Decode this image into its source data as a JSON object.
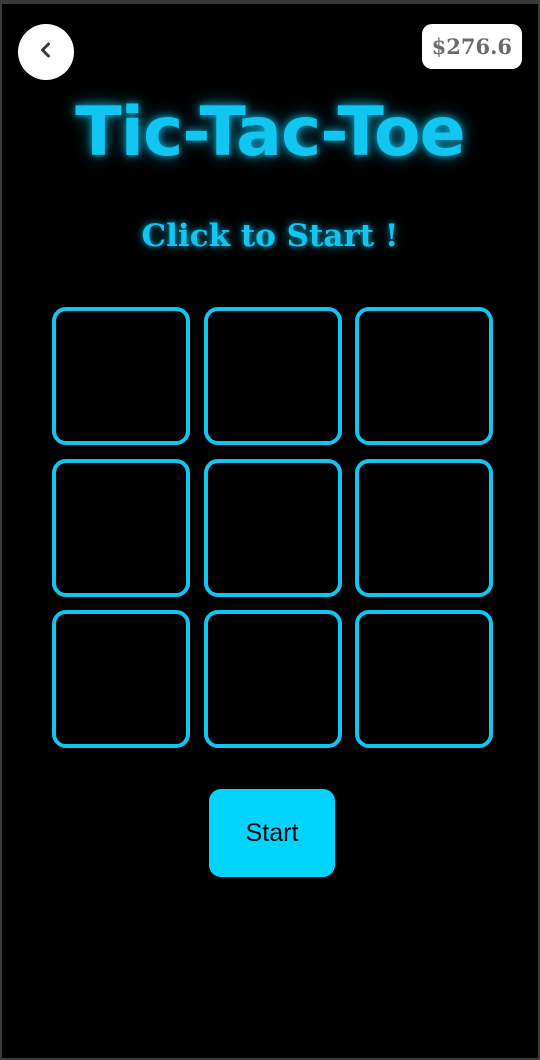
{
  "header": {
    "back_icon": "chevron-left-icon",
    "balance": "$276.6"
  },
  "game": {
    "title": "Tic-Tac-Toe",
    "status": "Click to Start !",
    "board": [
      {
        "mark": ""
      },
      {
        "mark": ""
      },
      {
        "mark": ""
      },
      {
        "mark": ""
      },
      {
        "mark": ""
      },
      {
        "mark": ""
      },
      {
        "mark": ""
      },
      {
        "mark": ""
      },
      {
        "mark": ""
      }
    ],
    "start_label": "Start"
  },
  "colors": {
    "background": "#000000",
    "accent": "#12c6f2",
    "button": "#00d4ff"
  }
}
